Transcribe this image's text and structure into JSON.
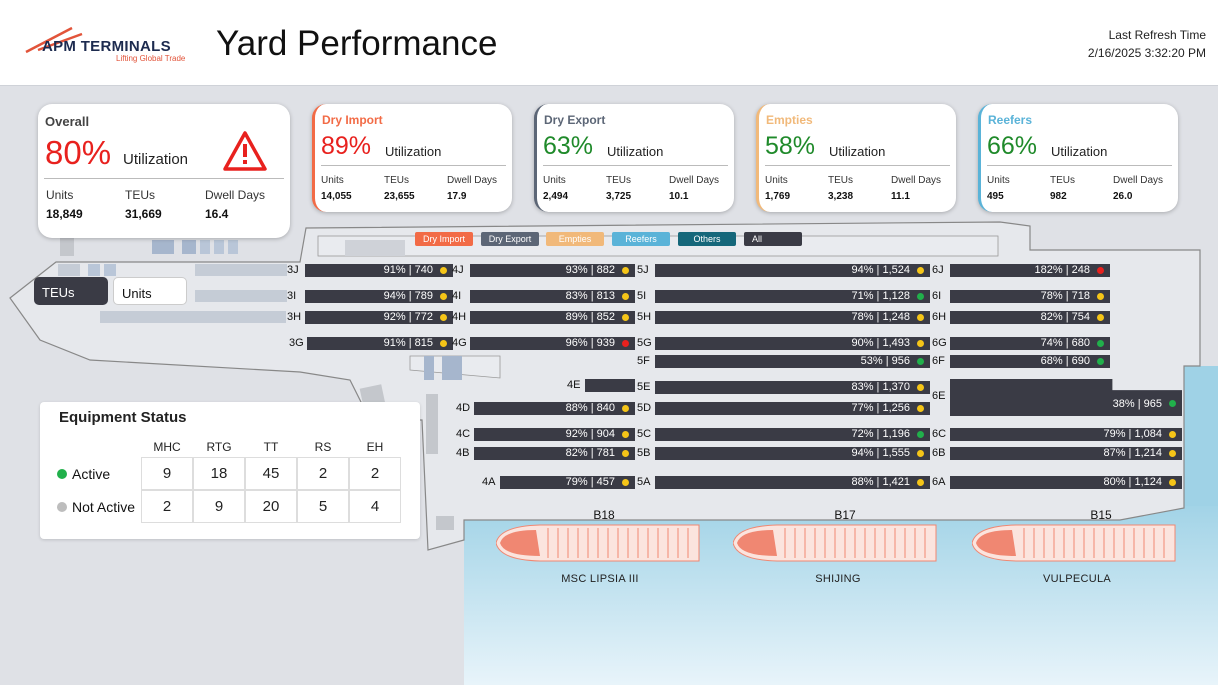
{
  "header": {
    "logo_text": "APM TERMINALS",
    "logo_tagline": "Lifting Global Trade",
    "title": "Yard Performance",
    "refresh_label": "Last Refresh Time",
    "refresh_time": "2/16/2025 3:32:20 PM"
  },
  "colors": {
    "critical": "#e8211e",
    "good": "#1f8a2a",
    "dry_import": "#f26b46",
    "dry_export": "#5c6676",
    "empties": "#f1b97a",
    "reefers": "#5ab3d8",
    "others": "#15677a",
    "all": "#3a3b45",
    "status_yellow": "#f5c518",
    "status_red": "#e8211e",
    "status_green": "#21b04b"
  },
  "kpi_cards": [
    {
      "title": "Overall",
      "utilization_pct": "80%",
      "utilization_label": "Utilization",
      "units_label": "Units",
      "units": "18,849",
      "teus_label": "TEUs",
      "teus": "31,669",
      "dwell_label": "Dwell Days",
      "dwell": "16.4",
      "icon": "warning-icon"
    },
    {
      "title": "Dry Import",
      "utilization_pct": "89%",
      "utilization_label": "Utilization",
      "units_label": "Units",
      "units": "14,055",
      "teus_label": "TEUs",
      "teus": "23,655",
      "dwell_label": "Dwell Days",
      "dwell": "17.9"
    },
    {
      "title": "Dry Export",
      "utilization_pct": "63%",
      "utilization_label": "Utilization",
      "units_label": "Units",
      "units": "2,494",
      "teus_label": "TEUs",
      "teus": "3,725",
      "dwell_label": "Dwell Days",
      "dwell": "10.1"
    },
    {
      "title": "Empties",
      "utilization_pct": "58%",
      "utilization_label": "Utilization",
      "units_label": "Units",
      "units": "1,769",
      "teus_label": "TEUs",
      "teus": "3,238",
      "dwell_label": "Dwell Days",
      "dwell": "11.1"
    },
    {
      "title": "Reefers",
      "utilization_pct": "66%",
      "utilization_label": "Utilization",
      "units_label": "Units",
      "units": "495",
      "teus_label": "TEUs",
      "teus": "982",
      "dwell_label": "Dwell Days",
      "dwell": "26.0"
    }
  ],
  "filters": [
    "Dry Import",
    "Dry Export",
    "Empties",
    "Reefers",
    "Others",
    "All"
  ],
  "measure_toggle": {
    "teus": "TEUs",
    "units": "Units",
    "selected": "TEUs"
  },
  "blocks": [
    {
      "id": "3J",
      "text": "91% | 740",
      "status": "yellow"
    },
    {
      "id": "3I",
      "text": "94% | 789",
      "status": "yellow"
    },
    {
      "id": "3H",
      "text": "92% | 772",
      "status": "yellow"
    },
    {
      "id": "3G",
      "text": "91% | 815",
      "status": "yellow"
    },
    {
      "id": "4J",
      "text": "93% | 882",
      "status": "yellow"
    },
    {
      "id": "4I",
      "text": "83% | 813",
      "status": "yellow"
    },
    {
      "id": "4H",
      "text": "89% | 852",
      "status": "yellow"
    },
    {
      "id": "4G",
      "text": "96% | 939",
      "status": "red"
    },
    {
      "id": "4E",
      "text": "",
      "status": ""
    },
    {
      "id": "4D",
      "text": "88% | 840",
      "status": "yellow"
    },
    {
      "id": "4C",
      "text": "92% | 904",
      "status": "yellow"
    },
    {
      "id": "4B",
      "text": "82% | 781",
      "status": "yellow"
    },
    {
      "id": "4A",
      "text": "79% | 457",
      "status": "yellow"
    },
    {
      "id": "5J",
      "text": "94% | 1,524",
      "status": "yellow"
    },
    {
      "id": "5I",
      "text": "71% | 1,128",
      "status": "green"
    },
    {
      "id": "5H",
      "text": "78% | 1,248",
      "status": "yellow"
    },
    {
      "id": "5G",
      "text": "90% | 1,493",
      "status": "yellow"
    },
    {
      "id": "5F",
      "text": "53% | 956",
      "status": "green"
    },
    {
      "id": "5E",
      "text": "83% | 1,370",
      "status": "yellow"
    },
    {
      "id": "5D",
      "text": "77% | 1,256",
      "status": "yellow"
    },
    {
      "id": "5C",
      "text": "72% | 1,196",
      "status": "green"
    },
    {
      "id": "5B",
      "text": "94% | 1,555",
      "status": "yellow"
    },
    {
      "id": "5A",
      "text": "88% | 1,421",
      "status": "yellow"
    },
    {
      "id": "6J",
      "text": "182% | 248",
      "status": "red"
    },
    {
      "id": "6I",
      "text": "78% | 718",
      "status": "yellow"
    },
    {
      "id": "6H",
      "text": "82% | 754",
      "status": "yellow"
    },
    {
      "id": "6G",
      "text": "74% | 680",
      "status": "green"
    },
    {
      "id": "6F",
      "text": "68% | 690",
      "status": "green"
    },
    {
      "id": "6E",
      "text": "38% | 965",
      "status": "green"
    },
    {
      "id": "6C",
      "text": "79% | 1,084",
      "status": "yellow"
    },
    {
      "id": "6B",
      "text": "87% | 1,214",
      "status": "yellow"
    },
    {
      "id": "6A",
      "text": "80% | 1,124",
      "status": "yellow"
    }
  ],
  "equipment": {
    "title": "Equipment Status",
    "columns": [
      "MHC",
      "RTG",
      "TT",
      "RS",
      "EH"
    ],
    "rows": [
      {
        "label": "Active",
        "status_color": "#21b04b",
        "values": [
          "9",
          "18",
          "45",
          "2",
          "2"
        ]
      },
      {
        "label": "Not Active",
        "status_color": "#bdbdbd",
        "values": [
          "2",
          "9",
          "20",
          "5",
          "4"
        ]
      }
    ]
  },
  "berths": [
    {
      "name": "B18",
      "vessel": "MSC LIPSIA III"
    },
    {
      "name": "B17",
      "vessel": "SHIJING"
    },
    {
      "name": "B15",
      "vessel": "VULPECULA"
    }
  ]
}
